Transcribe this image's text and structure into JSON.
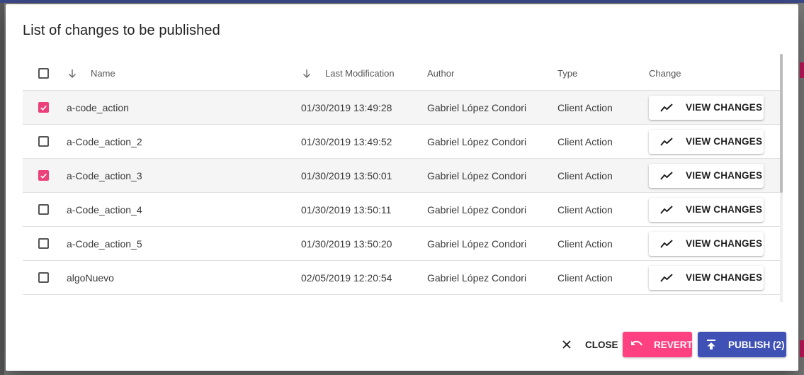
{
  "dialog": {
    "title": "List of changes to be published"
  },
  "table": {
    "headers": {
      "name": "Name",
      "last_modification": "Last Modification",
      "author": "Author",
      "type": "Type",
      "change": "Change"
    },
    "rows": [
      {
        "checked": true,
        "name": "a-code_action",
        "last_modification": "01/30/2019 13:49:28",
        "author": "Gabriel López Condori",
        "type": "Client Action",
        "change_label": "VIEW CHANGES"
      },
      {
        "checked": false,
        "name": "a-Code_action_2",
        "last_modification": "01/30/2019 13:49:52",
        "author": "Gabriel López Condori",
        "type": "Client Action",
        "change_label": "VIEW CHANGES"
      },
      {
        "checked": true,
        "name": "a-Code_action_3",
        "last_modification": "01/30/2019 13:50:01",
        "author": "Gabriel López Condori",
        "type": "Client Action",
        "change_label": "VIEW CHANGES"
      },
      {
        "checked": false,
        "name": "a-Code_action_4",
        "last_modification": "01/30/2019 13:50:11",
        "author": "Gabriel López Condori",
        "type": "Client Action",
        "change_label": "VIEW CHANGES"
      },
      {
        "checked": false,
        "name": "a-Code_action_5",
        "last_modification": "01/30/2019 13:50:20",
        "author": "Gabriel López Condori",
        "type": "Client Action",
        "change_label": "VIEW CHANGES"
      },
      {
        "checked": false,
        "name": "algoNuevo",
        "last_modification": "02/05/2019 12:20:54",
        "author": "Gabriel López Condori",
        "type": "Client Action",
        "change_label": "VIEW CHANGES"
      }
    ]
  },
  "actions": {
    "close_label": "CLOSE",
    "revert_label": "REVERT",
    "publish_label": "PUBLISH (2)"
  },
  "colors": {
    "accent_pink": "#ff4081",
    "checkbox_checked": "#ec407a",
    "primary_indigo": "#3f51b5"
  },
  "icons": {
    "sort": "arrow-down-icon",
    "view_changes": "trending-line-icon",
    "close": "close-icon",
    "revert": "undo-icon",
    "publish": "publish-upload-icon",
    "checkbox_checked": "check-icon"
  }
}
